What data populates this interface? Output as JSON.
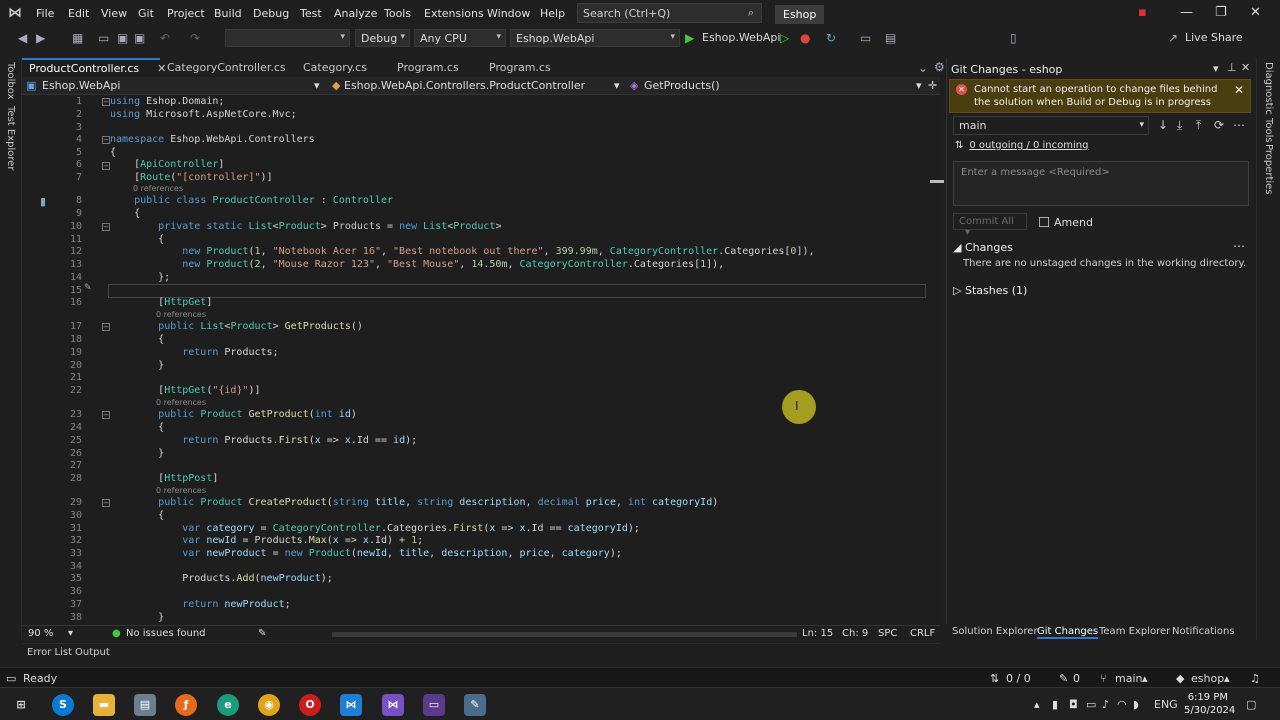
{
  "menu": [
    "File",
    "Edit",
    "View",
    "Git",
    "Project",
    "Build",
    "Debug",
    "Test",
    "Analyze",
    "Tools",
    "Extensions",
    "Window",
    "Help"
  ],
  "search": {
    "placeholder": "Search (Ctrl+Q)"
  },
  "solution_name": "Eshop",
  "toolbar": {
    "config": "Debug",
    "platform": "Any CPU",
    "startup_project": "Eshop.WebApi",
    "run_label": "Eshop.WebApi",
    "live_share": "Live Share"
  },
  "left_rail": {
    "toolbox": "Toolbox",
    "test_explorer": "Test Explorer"
  },
  "right_rail": {
    "diagnostic": "Diagnostic Tools",
    "properties": "Properties"
  },
  "tabs": [
    {
      "label": "ProductController.cs"
    },
    {
      "label": "CategoryController.cs"
    },
    {
      "label": "Category.cs"
    },
    {
      "label": "Program.cs"
    },
    {
      "label": "Program.cs"
    }
  ],
  "nav": {
    "project": "Eshop.WebApi",
    "type": "Eshop.WebApi.Controllers.ProductController",
    "member": "GetProducts()"
  },
  "refs_label": "0 references",
  "line_numbers": [
    "1",
    "2",
    "3",
    "4",
    "5",
    "6",
    "7",
    "8",
    "9",
    "10",
    "11",
    "12",
    "13",
    "14",
    "15",
    "16",
    "17",
    "18",
    "19",
    "20",
    "21",
    "22",
    "23",
    "24",
    "25",
    "26",
    "27",
    "28",
    "29",
    "30",
    "31",
    "32",
    "33",
    "34",
    "35",
    "36",
    "37",
    "38"
  ],
  "editor_status": {
    "zoom": "90 %",
    "issues": "No issues found",
    "ln": "Ln: 15",
    "ch": "Ch: 9",
    "spc": "SPC",
    "crlf": "CRLF"
  },
  "git": {
    "title": "Git Changes - eshop",
    "warning": "Cannot start an operation to change files behind the solution when Build or Debug is in progress",
    "branch": "main",
    "sync": "0 outgoing / 0 incoming",
    "message_placeholder": "Enter a message <Required>",
    "commit_all": "Commit All",
    "amend": "Amend",
    "changes_header": "Changes",
    "no_changes": "There are no unstaged changes in the working directory.",
    "stashes": "Stashes (1)"
  },
  "panel_tabs": [
    "Solution Explorer",
    "Git Changes",
    "Team Explorer",
    "Notifications"
  ],
  "bottom_tabs": [
    "Error List",
    "Output"
  ],
  "status": {
    "ready": "Ready",
    "lines": "0 / 0",
    "pencil": "0",
    "branch": "main",
    "repo": "eshop"
  },
  "taskbar": {
    "time": "6:19 PM",
    "date": "5/30/2024",
    "lang": "ENG"
  }
}
